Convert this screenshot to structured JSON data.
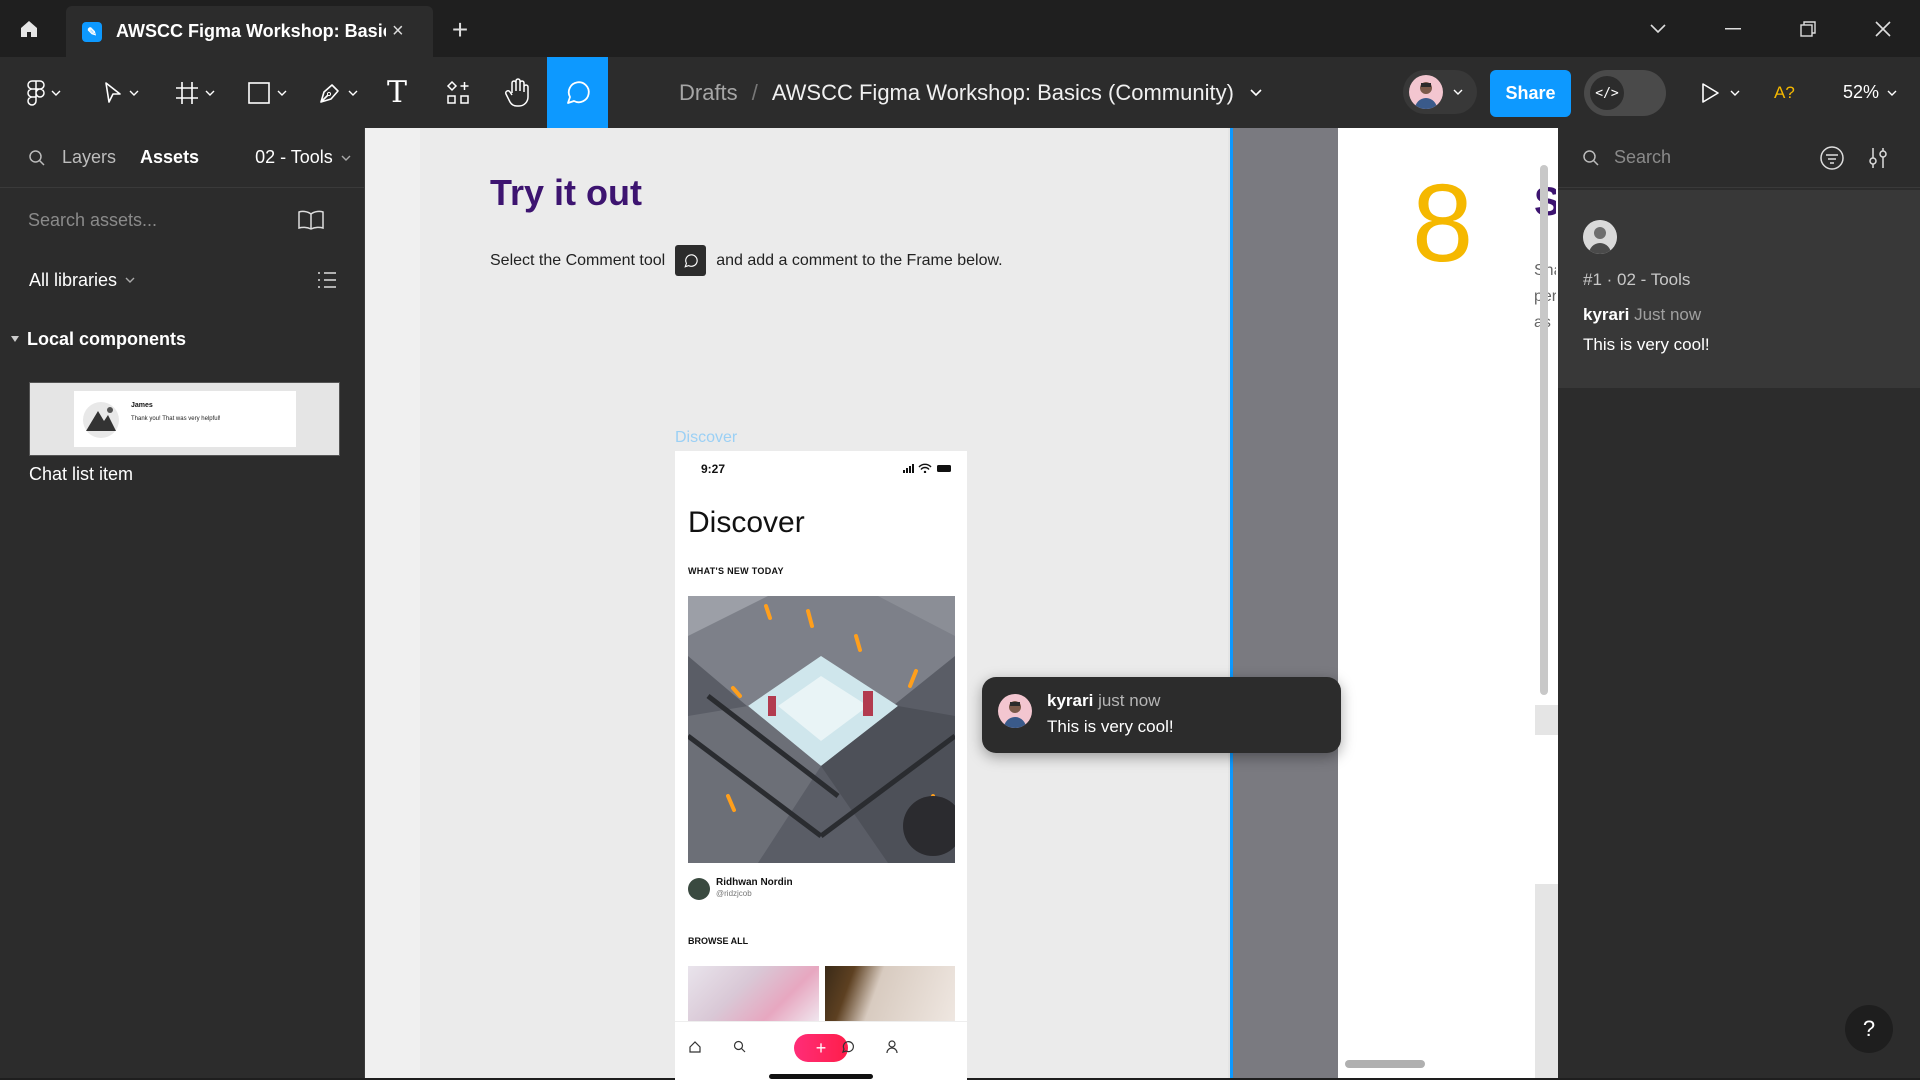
{
  "titlebar": {
    "tab_title": "AWSCC Figma Workshop: Basics (Community)",
    "tab_close": "×",
    "new_tab": "+"
  },
  "toolbar": {
    "breadcrumb_drafts": "Drafts",
    "breadcrumb_sep": "/",
    "file_name": "AWSCC Figma Workshop: Basics (Community)",
    "share_label": "Share",
    "dev_mode_label": "</>",
    "font_warning": "A?",
    "zoom": "52%",
    "text_tool": "T",
    "accent": "#0d99ff"
  },
  "left_panel": {
    "tab_layers": "Layers",
    "tab_assets": "Assets",
    "page_select": "02 - Tools",
    "search_placeholder": "Search assets...",
    "libraries": "All libraries",
    "section": "Local components",
    "component_name": "Chat list item",
    "preview_name": "James",
    "preview_text": "Thank you! That was very helpful!"
  },
  "canvas": {
    "heading": "Try it out",
    "instruction_before": "Select the Comment tool",
    "instruction_after": "and add a comment to the Frame below.",
    "frame_label": "Discover",
    "step_number": "8",
    "next_heading": "S",
    "next_snippet": [
      "Sha",
      "per",
      "as"
    ],
    "heading_color": "#3d1470",
    "number_color": "#f5b800"
  },
  "phone": {
    "time": "9:27",
    "title": "Discover",
    "section1": "WHAT'S NEW TODAY",
    "author": "Ridhwan Nordin",
    "handle": "@ridzjcob",
    "section2": "BROWSE ALL",
    "plus": "+"
  },
  "comment": {
    "author": "kyrari",
    "time": "just now",
    "text": "This is very cool!"
  },
  "right_panel": {
    "search_placeholder": "Search",
    "thread_ref": "#1 · 02 - Tools",
    "author": "kyrari",
    "time": "Just now",
    "text": "This is very cool!",
    "help": "?"
  }
}
